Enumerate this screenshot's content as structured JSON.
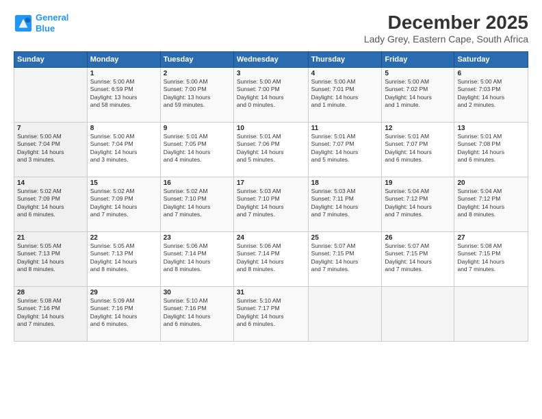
{
  "header": {
    "logo_line1": "General",
    "logo_line2": "Blue",
    "title": "December 2025",
    "subtitle": "Lady Grey, Eastern Cape, South Africa"
  },
  "days_of_week": [
    "Sunday",
    "Monday",
    "Tuesday",
    "Wednesday",
    "Thursday",
    "Friday",
    "Saturday"
  ],
  "weeks": [
    [
      {
        "day": "",
        "info": ""
      },
      {
        "day": "1",
        "info": "Sunrise: 5:00 AM\nSunset: 6:59 PM\nDaylight: 13 hours\nand 58 minutes."
      },
      {
        "day": "2",
        "info": "Sunrise: 5:00 AM\nSunset: 7:00 PM\nDaylight: 13 hours\nand 59 minutes."
      },
      {
        "day": "3",
        "info": "Sunrise: 5:00 AM\nSunset: 7:00 PM\nDaylight: 14 hours\nand 0 minutes."
      },
      {
        "day": "4",
        "info": "Sunrise: 5:00 AM\nSunset: 7:01 PM\nDaylight: 14 hours\nand 1 minute."
      },
      {
        "day": "5",
        "info": "Sunrise: 5:00 AM\nSunset: 7:02 PM\nDaylight: 14 hours\nand 1 minute."
      },
      {
        "day": "6",
        "info": "Sunrise: 5:00 AM\nSunset: 7:03 PM\nDaylight: 14 hours\nand 2 minutes."
      }
    ],
    [
      {
        "day": "7",
        "info": "Sunrise: 5:00 AM\nSunset: 7:04 PM\nDaylight: 14 hours\nand 3 minutes."
      },
      {
        "day": "8",
        "info": "Sunrise: 5:00 AM\nSunset: 7:04 PM\nDaylight: 14 hours\nand 3 minutes."
      },
      {
        "day": "9",
        "info": "Sunrise: 5:01 AM\nSunset: 7:05 PM\nDaylight: 14 hours\nand 4 minutes."
      },
      {
        "day": "10",
        "info": "Sunrise: 5:01 AM\nSunset: 7:06 PM\nDaylight: 14 hours\nand 5 minutes."
      },
      {
        "day": "11",
        "info": "Sunrise: 5:01 AM\nSunset: 7:07 PM\nDaylight: 14 hours\nand 5 minutes."
      },
      {
        "day": "12",
        "info": "Sunrise: 5:01 AM\nSunset: 7:07 PM\nDaylight: 14 hours\nand 6 minutes."
      },
      {
        "day": "13",
        "info": "Sunrise: 5:01 AM\nSunset: 7:08 PM\nDaylight: 14 hours\nand 6 minutes."
      }
    ],
    [
      {
        "day": "14",
        "info": "Sunrise: 5:02 AM\nSunset: 7:09 PM\nDaylight: 14 hours\nand 6 minutes."
      },
      {
        "day": "15",
        "info": "Sunrise: 5:02 AM\nSunset: 7:09 PM\nDaylight: 14 hours\nand 7 minutes."
      },
      {
        "day": "16",
        "info": "Sunrise: 5:02 AM\nSunset: 7:10 PM\nDaylight: 14 hours\nand 7 minutes."
      },
      {
        "day": "17",
        "info": "Sunrise: 5:03 AM\nSunset: 7:10 PM\nDaylight: 14 hours\nand 7 minutes."
      },
      {
        "day": "18",
        "info": "Sunrise: 5:03 AM\nSunset: 7:11 PM\nDaylight: 14 hours\nand 7 minutes."
      },
      {
        "day": "19",
        "info": "Sunrise: 5:04 AM\nSunset: 7:12 PM\nDaylight: 14 hours\nand 7 minutes."
      },
      {
        "day": "20",
        "info": "Sunrise: 5:04 AM\nSunset: 7:12 PM\nDaylight: 14 hours\nand 8 minutes."
      }
    ],
    [
      {
        "day": "21",
        "info": "Sunrise: 5:05 AM\nSunset: 7:13 PM\nDaylight: 14 hours\nand 8 minutes."
      },
      {
        "day": "22",
        "info": "Sunrise: 5:05 AM\nSunset: 7:13 PM\nDaylight: 14 hours\nand 8 minutes."
      },
      {
        "day": "23",
        "info": "Sunrise: 5:06 AM\nSunset: 7:14 PM\nDaylight: 14 hours\nand 8 minutes."
      },
      {
        "day": "24",
        "info": "Sunrise: 5:06 AM\nSunset: 7:14 PM\nDaylight: 14 hours\nand 8 minutes."
      },
      {
        "day": "25",
        "info": "Sunrise: 5:07 AM\nSunset: 7:15 PM\nDaylight: 14 hours\nand 7 minutes."
      },
      {
        "day": "26",
        "info": "Sunrise: 5:07 AM\nSunset: 7:15 PM\nDaylight: 14 hours\nand 7 minutes."
      },
      {
        "day": "27",
        "info": "Sunrise: 5:08 AM\nSunset: 7:15 PM\nDaylight: 14 hours\nand 7 minutes."
      }
    ],
    [
      {
        "day": "28",
        "info": "Sunrise: 5:08 AM\nSunset: 7:16 PM\nDaylight: 14 hours\nand 7 minutes."
      },
      {
        "day": "29",
        "info": "Sunrise: 5:09 AM\nSunset: 7:16 PM\nDaylight: 14 hours\nand 6 minutes."
      },
      {
        "day": "30",
        "info": "Sunrise: 5:10 AM\nSunset: 7:16 PM\nDaylight: 14 hours\nand 6 minutes."
      },
      {
        "day": "31",
        "info": "Sunrise: 5:10 AM\nSunset: 7:17 PM\nDaylight: 14 hours\nand 6 minutes."
      },
      {
        "day": "",
        "info": ""
      },
      {
        "day": "",
        "info": ""
      },
      {
        "day": "",
        "info": ""
      }
    ]
  ]
}
